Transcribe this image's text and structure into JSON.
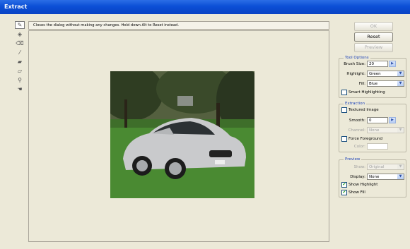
{
  "window": {
    "title": "Extract"
  },
  "hint": {
    "text": "Closes the dialog without making any changes. Hold down Alt to Reset instead."
  },
  "tools": [
    {
      "name": "edge-highlighter-icon",
      "glyph": "✎"
    },
    {
      "name": "fill-tool-icon",
      "glyph": "◈"
    },
    {
      "name": "eraser-icon",
      "glyph": "⌫"
    },
    {
      "name": "eyedropper-icon",
      "glyph": "⁄"
    },
    {
      "name": "cleanup-tool-icon",
      "glyph": "▰"
    },
    {
      "name": "edge-touchup-icon",
      "glyph": "▱"
    },
    {
      "name": "zoom-icon",
      "glyph": "⚲"
    },
    {
      "name": "hand-icon",
      "glyph": "☚"
    }
  ],
  "buttons": {
    "ok": "OK",
    "reset": "Reset",
    "preview": "Preview"
  },
  "tool_options": {
    "title": "Tool Options",
    "brush_size_label": "Brush Size:",
    "brush_size_value": "20",
    "highlight_label": "Highlight:",
    "highlight_value": "Green",
    "fill_label": "Fill:",
    "fill_value": "Blue",
    "smart_highlighting_label": "Smart Highlighting",
    "smart_highlighting_checked": false
  },
  "extraction": {
    "title": "Extraction",
    "textured_image_label": "Textured Image",
    "textured_image_checked": false,
    "smooth_label": "Smooth:",
    "smooth_value": "0",
    "channel_label": "Channel:",
    "channel_value": "None",
    "force_foreground_label": "Force Foreground",
    "force_foreground_checked": false,
    "color_label": "Color:"
  },
  "preview_group": {
    "title": "Preview",
    "show_label": "Show:",
    "show_value": "Original",
    "display_label": "Display:",
    "display_value": "None",
    "show_highlight_label": "Show Highlight",
    "show_highlight_checked": true,
    "show_fill_label": "Show Fill",
    "show_fill_checked": true
  },
  "colors": {
    "accent": "#0b4fd6",
    "group_title": "#1f44b8",
    "dialog_bg": "#ece9d8"
  }
}
